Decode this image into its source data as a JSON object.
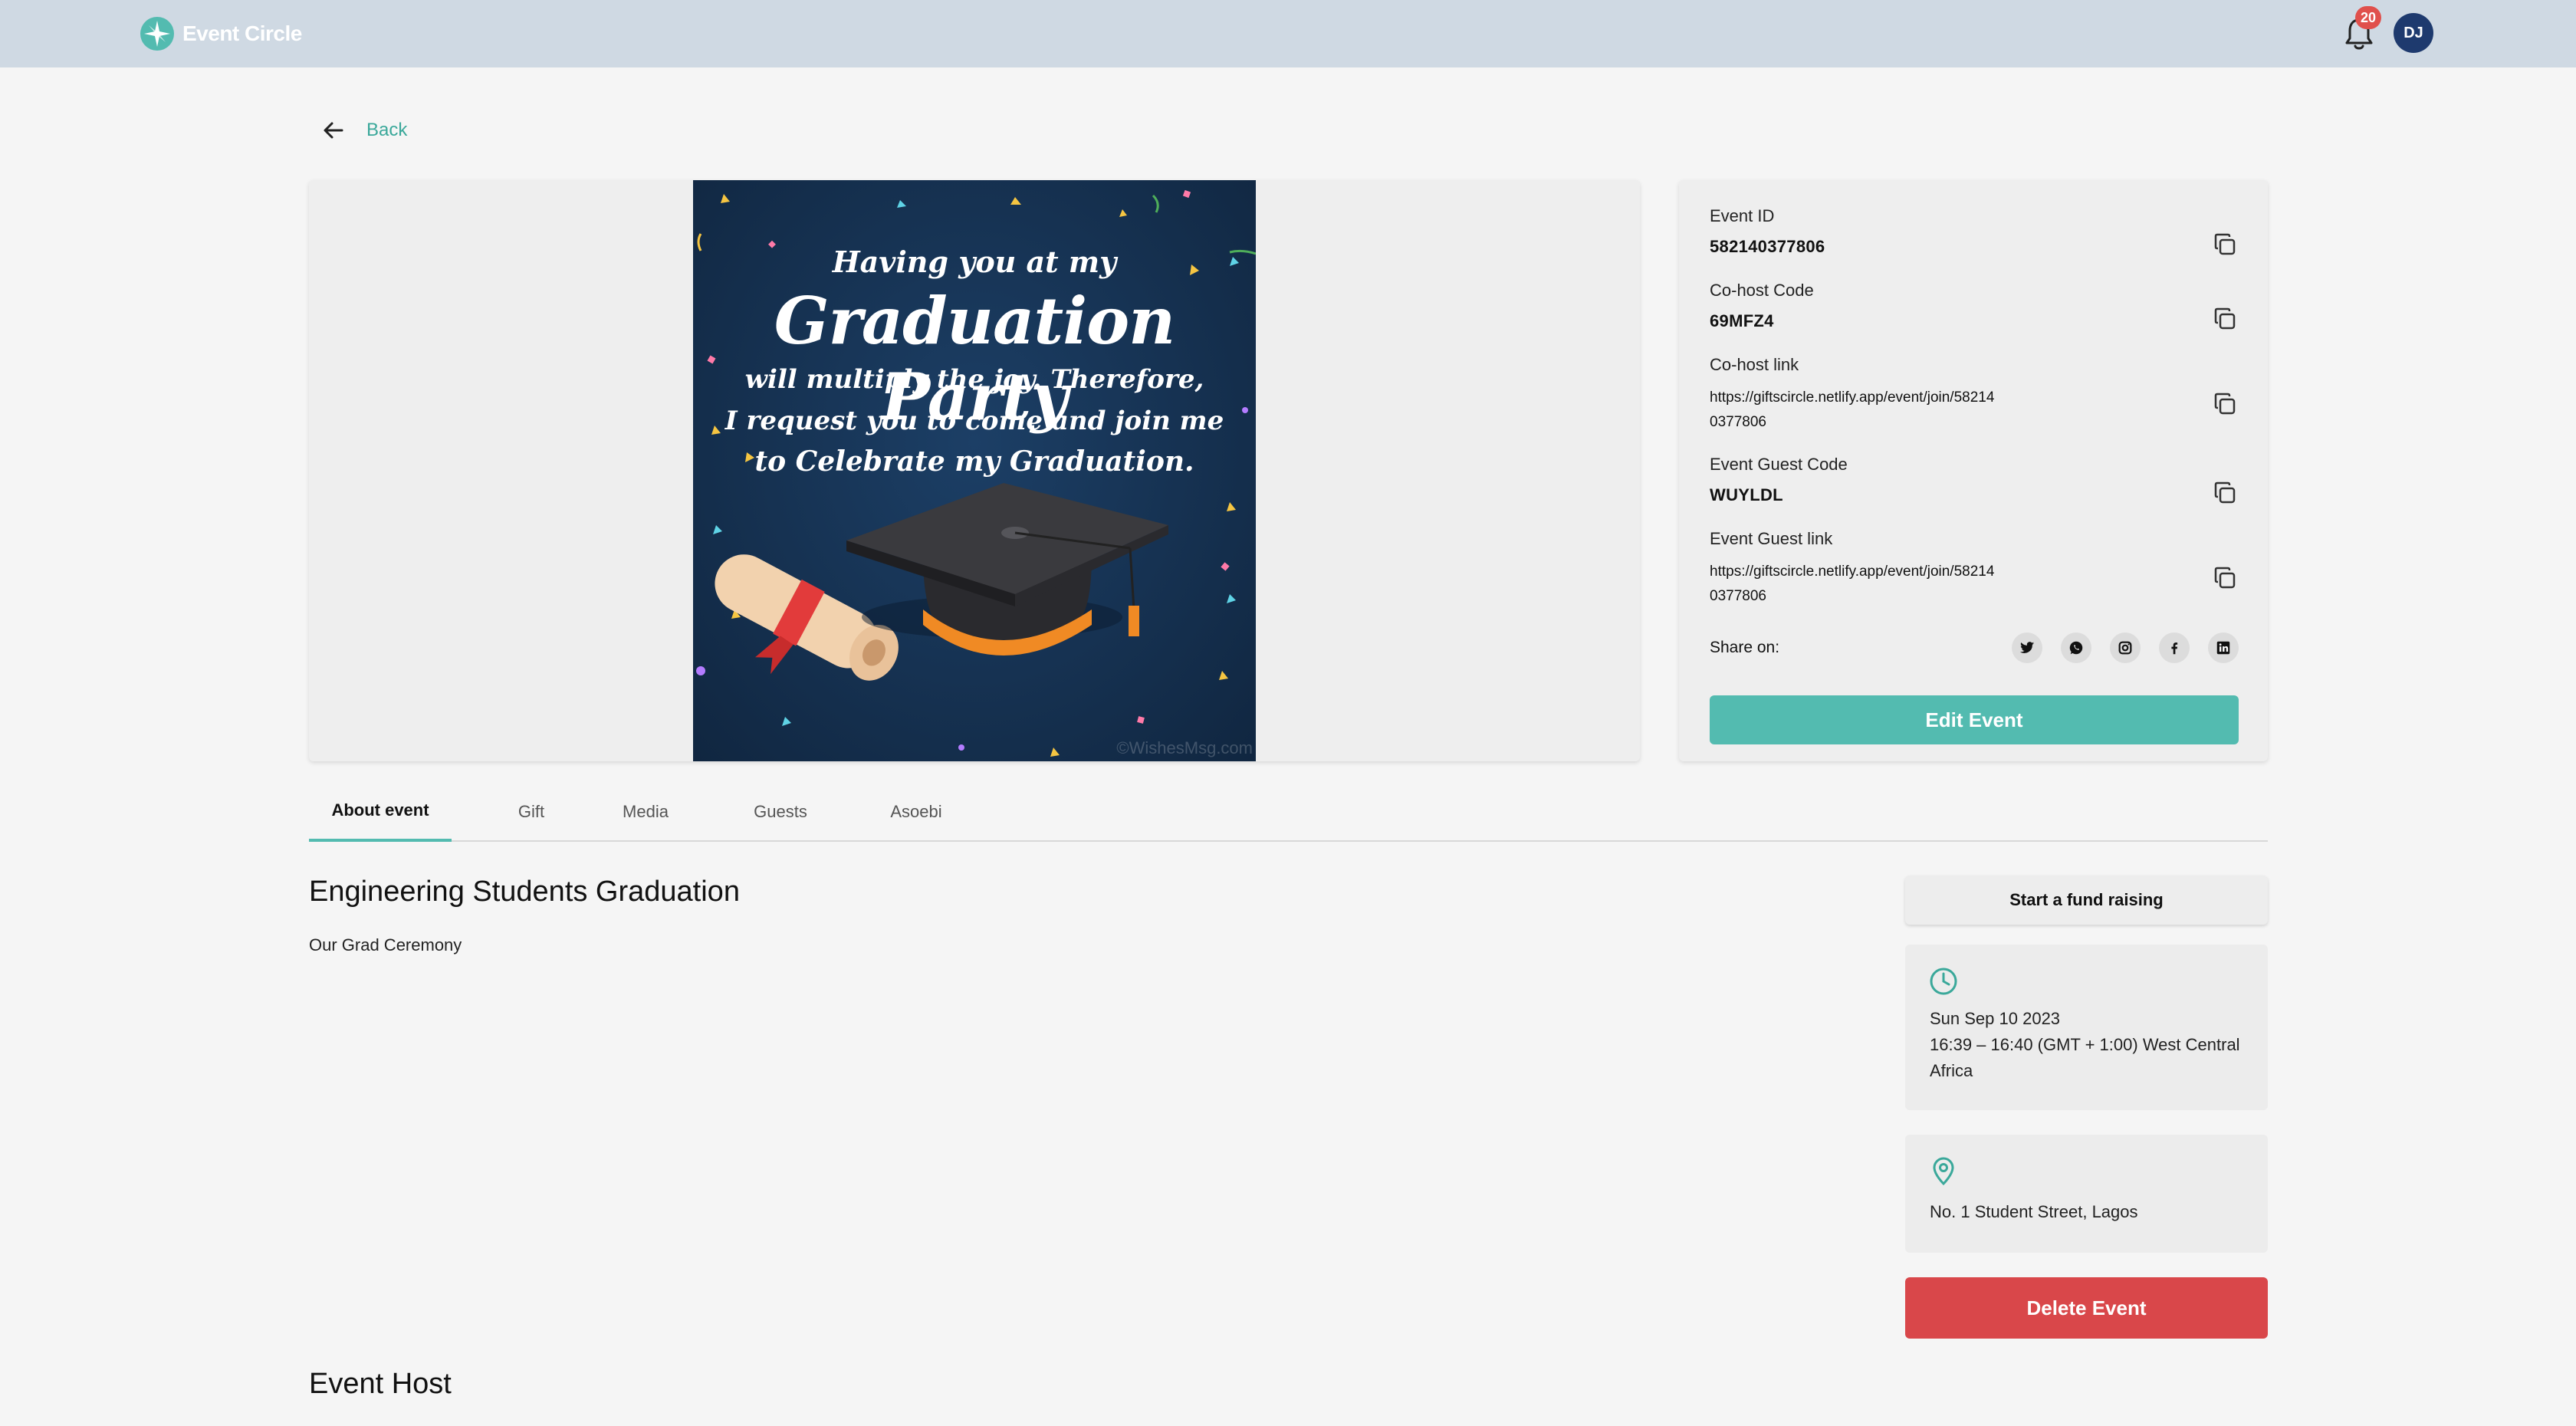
{
  "app": {
    "name": "Event Circle",
    "logo_icon": "compass-star-icon",
    "accent": "#53bbb0"
  },
  "header": {
    "notifications": {
      "icon": "bell-icon",
      "count": "20"
    },
    "avatar": {
      "initials": "DJ",
      "color": "#1e3a6e"
    }
  },
  "nav": {
    "back_label": "Back",
    "back_icon": "arrow-left-icon"
  },
  "invite_image": {
    "line1": "Having you at my",
    "line2": "Graduation Party",
    "line3": "will multiply the joy. Therefore,",
    "line4": "I request you to come and join me",
    "line5": "to Celebrate my Graduation.",
    "watermark": "©WishesMsg.com"
  },
  "details": {
    "event_id": {
      "label": "Event ID",
      "value": "582140377806"
    },
    "cohost_code": {
      "label": "Co-host Code",
      "value": "69MFZ4"
    },
    "cohost_link": {
      "label": "Co-host link",
      "value": "https://giftscircle.netlify.app/event/join/582140377806"
    },
    "guest_code": {
      "label": "Event Guest Code",
      "value": "WUYLDL"
    },
    "guest_link": {
      "label": "Event Guest link",
      "value": "https://giftscircle.netlify.app/event/join/582140377806"
    },
    "share_label": "Share on:",
    "share_icons": [
      "twitter-icon",
      "whatsapp-icon",
      "instagram-icon",
      "facebook-icon",
      "linkedin-icon"
    ],
    "edit_label": "Edit Event"
  },
  "tabs": [
    {
      "label": "About event",
      "active": true
    },
    {
      "label": "Gift",
      "active": false
    },
    {
      "label": "Media",
      "active": false
    },
    {
      "label": "Guests",
      "active": false
    },
    {
      "label": "Asoebi",
      "active": false
    }
  ],
  "about": {
    "title": "Engineering Students Graduation",
    "description": "Our Grad Ceremony",
    "host_heading": "Event Host"
  },
  "sidebar": {
    "fund_label": "Start a fund raising",
    "date": "Sun Sep 10 2023",
    "time": "16:39 – 16:40 (GMT + 1:00) West Central Africa",
    "location": "No. 1 Student Street, Lagos",
    "delete_label": "Delete Event",
    "delete_color": "#d9474a"
  }
}
